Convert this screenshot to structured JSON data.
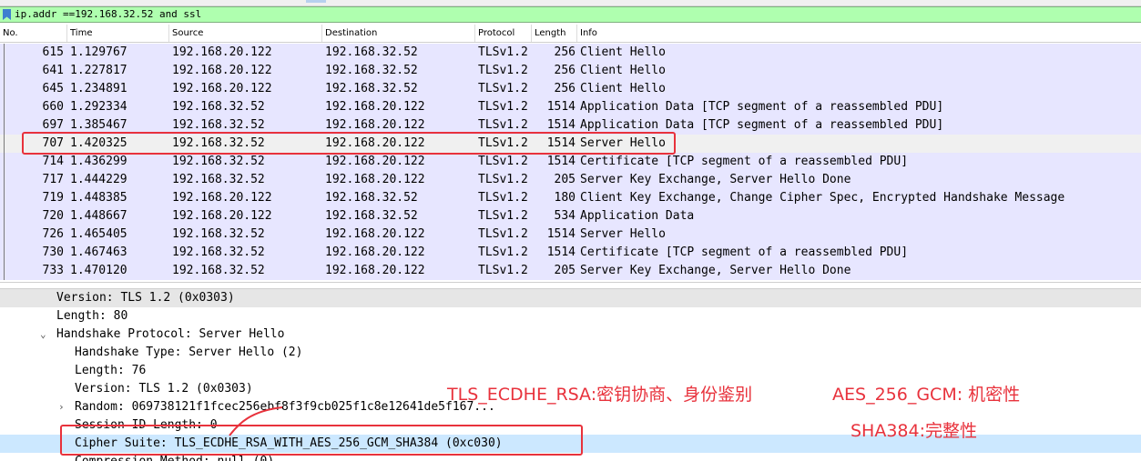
{
  "filter": {
    "value": "ip.addr ==192.168.32.52 and ssl"
  },
  "columns": {
    "no": "No.",
    "time": "Time",
    "source": "Source",
    "destination": "Destination",
    "protocol": "Protocol",
    "length": "Length",
    "info": "Info"
  },
  "packets": [
    {
      "no": "615",
      "time": "1.129767",
      "source": "192.168.20.122",
      "destination": "192.168.32.52",
      "protocol": "TLSv1.2",
      "length": "256",
      "info": "Client Hello"
    },
    {
      "no": "641",
      "time": "1.227817",
      "source": "192.168.20.122",
      "destination": "192.168.32.52",
      "protocol": "TLSv1.2",
      "length": "256",
      "info": "Client Hello"
    },
    {
      "no": "645",
      "time": "1.234891",
      "source": "192.168.20.122",
      "destination": "192.168.32.52",
      "protocol": "TLSv1.2",
      "length": "256",
      "info": "Client Hello"
    },
    {
      "no": "660",
      "time": "1.292334",
      "source": "192.168.32.52",
      "destination": "192.168.20.122",
      "protocol": "TLSv1.2",
      "length": "1514",
      "info": "Application Data [TCP segment of a reassembled PDU]"
    },
    {
      "no": "697",
      "time": "1.385467",
      "source": "192.168.32.52",
      "destination": "192.168.20.122",
      "protocol": "TLSv1.2",
      "length": "1514",
      "info": "Application Data [TCP segment of a reassembled PDU]"
    },
    {
      "no": "707",
      "time": "1.420325",
      "source": "192.168.32.52",
      "destination": "192.168.20.122",
      "protocol": "TLSv1.2",
      "length": "1514",
      "info": "Server Hello"
    },
    {
      "no": "714",
      "time": "1.436299",
      "source": "192.168.32.52",
      "destination": "192.168.20.122",
      "protocol": "TLSv1.2",
      "length": "1514",
      "info": "Certificate [TCP segment of a reassembled PDU]"
    },
    {
      "no": "717",
      "time": "1.444229",
      "source": "192.168.32.52",
      "destination": "192.168.20.122",
      "protocol": "TLSv1.2",
      "length": "205",
      "info": "Server Key Exchange, Server Hello Done"
    },
    {
      "no": "719",
      "time": "1.448385",
      "source": "192.168.20.122",
      "destination": "192.168.32.52",
      "protocol": "TLSv1.2",
      "length": "180",
      "info": "Client Key Exchange, Change Cipher Spec, Encrypted Handshake Message"
    },
    {
      "no": "720",
      "time": "1.448667",
      "source": "192.168.20.122",
      "destination": "192.168.32.52",
      "protocol": "TLSv1.2",
      "length": "534",
      "info": "Application Data"
    },
    {
      "no": "726",
      "time": "1.465405",
      "source": "192.168.32.52",
      "destination": "192.168.20.122",
      "protocol": "TLSv1.2",
      "length": "1514",
      "info": "Server Hello"
    },
    {
      "no": "730",
      "time": "1.467463",
      "source": "192.168.32.52",
      "destination": "192.168.20.122",
      "protocol": "TLSv1.2",
      "length": "1514",
      "info": "Certificate [TCP segment of a reassembled PDU]"
    },
    {
      "no": "733",
      "time": "1.470120",
      "source": "192.168.32.52",
      "destination": "192.168.20.122",
      "protocol": "TLSv1.2",
      "length": "205",
      "info": "Server Key Exchange, Server Hello Done"
    }
  ],
  "selected_packet_no": "707",
  "details": [
    {
      "text": "Version: TLS 1.2 (0x0303)",
      "level": 0,
      "arrow": "",
      "state": "hl"
    },
    {
      "text": "Length: 80",
      "level": 0,
      "arrow": "",
      "state": ""
    },
    {
      "text": "Handshake Protocol: Server Hello",
      "level": 0,
      "arrow": "expanded",
      "state": ""
    },
    {
      "text": "Handshake Type: Server Hello (2)",
      "level": 1,
      "arrow": "",
      "state": ""
    },
    {
      "text": "Length: 76",
      "level": 1,
      "arrow": "",
      "state": ""
    },
    {
      "text": "Version: TLS 1.2 (0x0303)",
      "level": 1,
      "arrow": "",
      "state": ""
    },
    {
      "text": "Random: 069738121f1fcec256ebf8f3f9cb025f1c8e12641de5f167...",
      "level": 1,
      "arrow": "collapsed",
      "state": ""
    },
    {
      "text": "Session ID Length: 0",
      "level": 1,
      "arrow": "",
      "state": ""
    },
    {
      "text": "Cipher Suite: TLS_ECDHE_RSA_WITH_AES_256_GCM_SHA384 (0xc030)",
      "level": 1,
      "arrow": "",
      "state": "sel"
    },
    {
      "text": "Compression Method: null (0)",
      "level": 1,
      "arrow": "",
      "state": ""
    }
  ],
  "annotations": {
    "key_exchange": "TLS_ECDHE_RSA:密钥协商、身份鉴别",
    "cipher": "AES_256_GCM: 机密性",
    "hash": "SHA384:完整性"
  },
  "colors": {
    "filter_bg": "#afffaf",
    "row_bg": "#e7e6ff",
    "selected_detail": "#cce8ff",
    "annotation": "#e8323c"
  }
}
